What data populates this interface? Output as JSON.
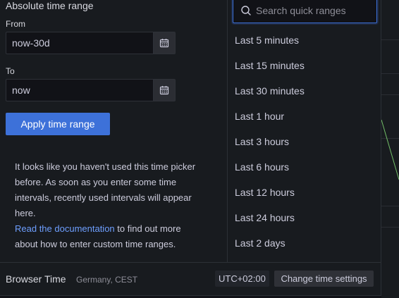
{
  "absolute": {
    "title": "Absolute time range",
    "from_label": "From",
    "from_value": "now-30d",
    "to_label": "To",
    "to_value": "now",
    "apply_label": "Apply time range"
  },
  "help": {
    "text": "It looks like you haven't used this time picker before. As soon as you enter some time intervals, recently used intervals will appear here.",
    "link": "Read the documentation",
    "after_link": " to find out more about how to enter custom time ranges."
  },
  "quick": {
    "placeholder": "Search quick ranges",
    "items": [
      {
        "label": "Last 5 minutes"
      },
      {
        "label": "Last 15 minutes"
      },
      {
        "label": "Last 30 minutes"
      },
      {
        "label": "Last 1 hour"
      },
      {
        "label": "Last 3 hours"
      },
      {
        "label": "Last 6 hours"
      },
      {
        "label": "Last 12 hours"
      },
      {
        "label": "Last 24 hours"
      },
      {
        "label": "Last 2 days"
      }
    ]
  },
  "footer": {
    "browser_time": "Browser Time",
    "timezone": "Germany, CEST",
    "utc": "UTC+02:00",
    "change_label": "Change time settings"
  },
  "colors": {
    "accent": "#3d71d9",
    "link": "#6e9fff",
    "background": "#181b1f",
    "series_line": "#73bf69"
  },
  "icons": [
    "calendar-icon",
    "search-icon"
  ]
}
